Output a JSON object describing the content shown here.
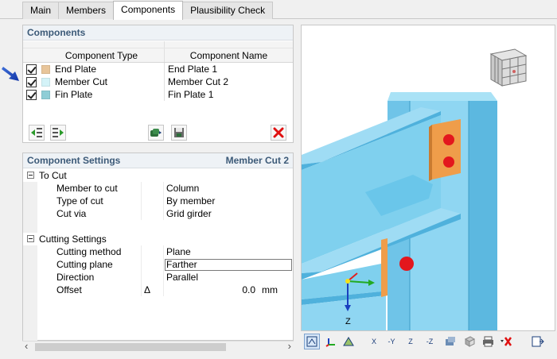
{
  "tabs": [
    {
      "label": "Main"
    },
    {
      "label": "Members"
    },
    {
      "label": "Components",
      "active": true
    },
    {
      "label": "Plausibility Check"
    }
  ],
  "components": {
    "title": "Components",
    "columns": {
      "type": "Component Type",
      "name": "Component Name"
    },
    "rows": [
      {
        "checked": true,
        "type": "End Plate",
        "name": "End Plate 1",
        "color": "#e8c59a"
      },
      {
        "checked": true,
        "type": "Member Cut",
        "name": "Member Cut 2",
        "color": "#d4f3f8"
      },
      {
        "checked": true,
        "type": "Fin Plate",
        "name": "Fin Plate 1",
        "color": "#8ecdd6"
      }
    ]
  },
  "toolbar": {
    "icons": [
      "insert-component-icon",
      "remove-from-list-icon",
      "library-icon",
      "save-component-icon",
      "delete-icon"
    ]
  },
  "settings": {
    "title": "Component Settings",
    "subject": "Member Cut 2",
    "groups": [
      {
        "label": "To Cut",
        "rows": [
          {
            "key": "Member to cut",
            "symbol": "",
            "value": "Column",
            "unit": ""
          },
          {
            "key": "Type of cut",
            "symbol": "",
            "value": "By member",
            "unit": ""
          },
          {
            "key": "Cut via",
            "symbol": "",
            "value": "Grid girder",
            "unit": ""
          }
        ]
      },
      {
        "label": "Cutting Settings",
        "rows": [
          {
            "key": "Cutting method",
            "symbol": "",
            "value": "Plane",
            "unit": ""
          },
          {
            "key": "Cutting plane",
            "symbol": "",
            "value": "Farther",
            "unit": ""
          },
          {
            "key": "Direction",
            "symbol": "",
            "value": "Parallel",
            "unit": ""
          },
          {
            "key": "Offset",
            "symbol": "Δ",
            "value": "0.0",
            "unit": "mm"
          }
        ]
      }
    ]
  },
  "scroll": {
    "left_arrow": "‹",
    "right_arrow": "›"
  },
  "viewport": {
    "axis_label": "Z",
    "colors": {
      "steel": "#7fd0ee",
      "steel_dark": "#4aa7cf",
      "plate": "#ef9d4a",
      "bolt": "#e3171d",
      "axis_x": "#e02020",
      "axis_y": "#22aa22",
      "axis_z": "#1a3fbf"
    },
    "nav_cube": "view-cube-icon"
  },
  "view_toolbar": {
    "icons": [
      "view-mode-icon",
      "axes-icon",
      "render-icon",
      "view-x-icon",
      "view-neg-y-icon",
      "view-z-icon",
      "view-neg-z-icon",
      "display-icon",
      "isometric-icon",
      "print-icon",
      "clear-icon",
      "exit-icon"
    ],
    "labels": [
      "X",
      "-Y",
      "Z",
      "-Z"
    ]
  }
}
